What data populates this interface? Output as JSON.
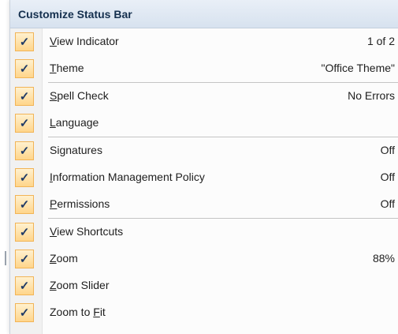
{
  "menu": {
    "title": "Customize Status Bar",
    "groups": [
      [
        {
          "id": "view-indicator",
          "pre": "",
          "mnemonic": "V",
          "post": "iew Indicator",
          "value": "1 of 2",
          "checked": true
        },
        {
          "id": "theme",
          "pre": "",
          "mnemonic": "T",
          "post": "heme",
          "value": "\"Office Theme\"",
          "checked": true
        }
      ],
      [
        {
          "id": "spell-check",
          "pre": "",
          "mnemonic": "S",
          "post": "pell Check",
          "value": "No Errors",
          "checked": true
        },
        {
          "id": "language",
          "pre": "",
          "mnemonic": "L",
          "post": "anguage",
          "value": "",
          "checked": true
        }
      ],
      [
        {
          "id": "signatures",
          "pre": "Si",
          "mnemonic": "g",
          "post": "natures",
          "value": "Off",
          "checked": true
        },
        {
          "id": "information-management-policy",
          "pre": "",
          "mnemonic": "I",
          "post": "nformation Management Policy",
          "value": "Off",
          "checked": true
        },
        {
          "id": "permissions",
          "pre": "",
          "mnemonic": "P",
          "post": "ermissions",
          "value": "Off",
          "checked": true
        }
      ],
      [
        {
          "id": "view-shortcuts",
          "pre": "",
          "mnemonic": "V",
          "post": "iew Shortcuts",
          "value": "",
          "checked": true
        },
        {
          "id": "zoom",
          "pre": "",
          "mnemonic": "Z",
          "post": "oom",
          "value": "88%",
          "checked": true
        },
        {
          "id": "zoom-slider",
          "pre": "",
          "mnemonic": "Z",
          "post": "oom Slider",
          "value": "",
          "checked": true
        },
        {
          "id": "zoom-to-fit",
          "pre": "Zoom to ",
          "mnemonic": "F",
          "post": "it",
          "value": "",
          "checked": true
        }
      ]
    ],
    "check_glyph": "✓",
    "colors": {
      "check_bg": "#ffd58a",
      "check_border": "#f2b456",
      "header_bg": "#dbe5f1"
    }
  }
}
